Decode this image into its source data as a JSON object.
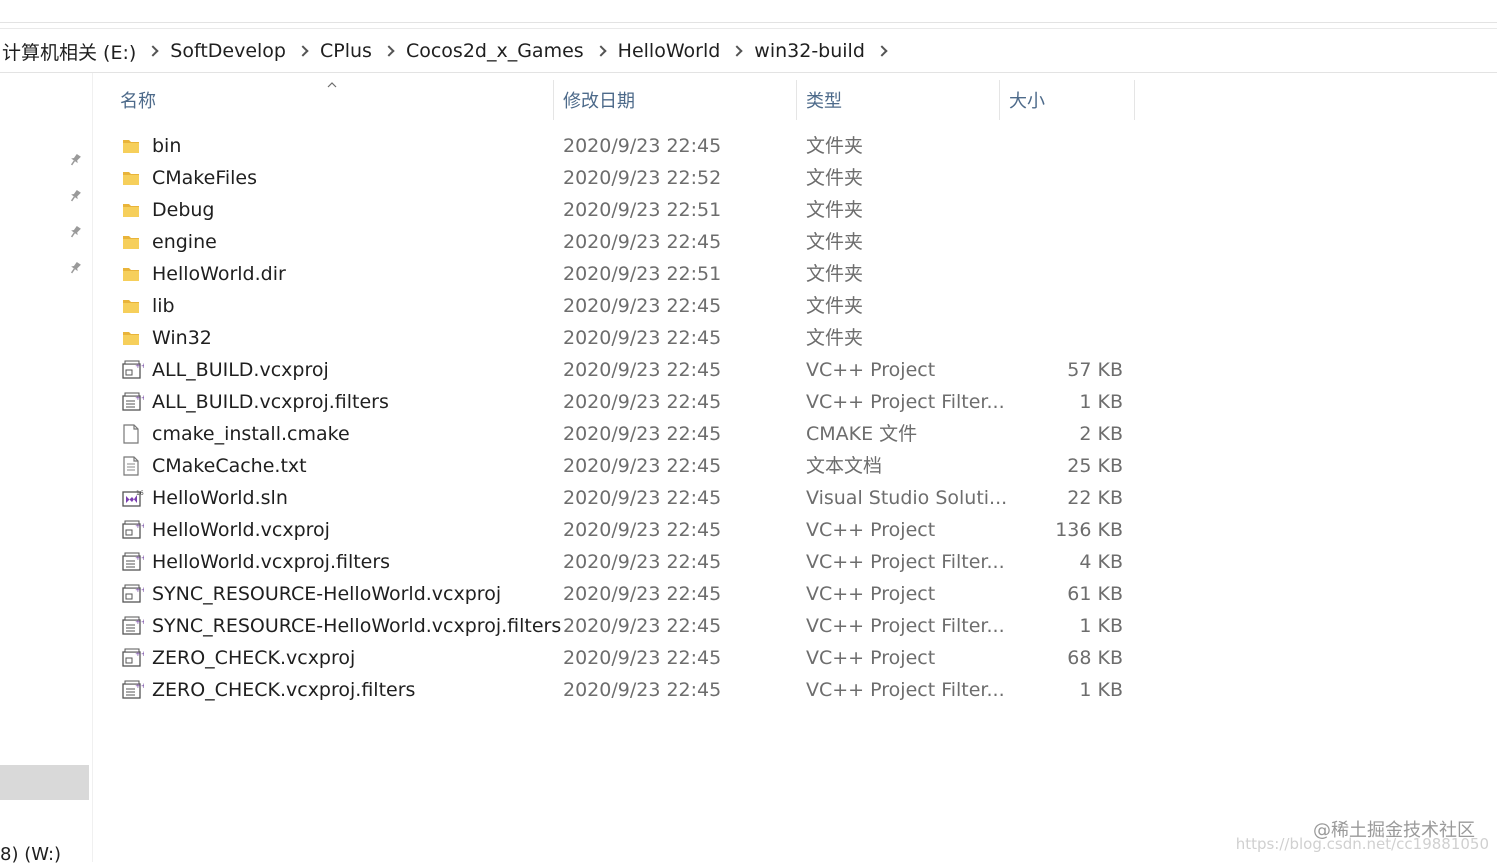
{
  "breadcrumb": [
    "计算机相关 (E:)",
    "SoftDevelop",
    "CPlus",
    "Cocos2d_x_Games",
    "HelloWorld",
    "win32-build"
  ],
  "nav_pane": {
    "drive_label": "8) (W:)"
  },
  "columns": {
    "name": "名称",
    "date": "修改日期",
    "type": "类型",
    "size": "大小"
  },
  "files": [
    {
      "name": "bin",
      "date": "2020/9/23 22:45",
      "type": "文件夹",
      "size": "",
      "icon": "folder-icon"
    },
    {
      "name": "CMakeFiles",
      "date": "2020/9/23 22:52",
      "type": "文件夹",
      "size": "",
      "icon": "folder-icon"
    },
    {
      "name": "Debug",
      "date": "2020/9/23 22:51",
      "type": "文件夹",
      "size": "",
      "icon": "folder-icon"
    },
    {
      "name": "engine",
      "date": "2020/9/23 22:45",
      "type": "文件夹",
      "size": "",
      "icon": "folder-icon"
    },
    {
      "name": "HelloWorld.dir",
      "date": "2020/9/23 22:51",
      "type": "文件夹",
      "size": "",
      "icon": "folder-icon"
    },
    {
      "name": "lib",
      "date": "2020/9/23 22:45",
      "type": "文件夹",
      "size": "",
      "icon": "folder-icon"
    },
    {
      "name": "Win32",
      "date": "2020/9/23 22:45",
      "type": "文件夹",
      "size": "",
      "icon": "folder-icon"
    },
    {
      "name": "ALL_BUILD.vcxproj",
      "date": "2020/9/23 22:45",
      "type": "VC++ Project",
      "size": "57 KB",
      "icon": "vcxproj-icon"
    },
    {
      "name": "ALL_BUILD.vcxproj.filters",
      "date": "2020/9/23 22:45",
      "type": "VC++ Project Filter...",
      "size": "1 KB",
      "icon": "filters-icon"
    },
    {
      "name": "cmake_install.cmake",
      "date": "2020/9/23 22:45",
      "type": "CMAKE 文件",
      "size": "2 KB",
      "icon": "blank-file-icon"
    },
    {
      "name": "CMakeCache.txt",
      "date": "2020/9/23 22:45",
      "type": "文本文档",
      "size": "25 KB",
      "icon": "text-file-icon"
    },
    {
      "name": "HelloWorld.sln",
      "date": "2020/9/23 22:45",
      "type": "Visual Studio Soluti...",
      "size": "22 KB",
      "icon": "sln-icon"
    },
    {
      "name": "HelloWorld.vcxproj",
      "date": "2020/9/23 22:45",
      "type": "VC++ Project",
      "size": "136 KB",
      "icon": "vcxproj-icon"
    },
    {
      "name": "HelloWorld.vcxproj.filters",
      "date": "2020/9/23 22:45",
      "type": "VC++ Project Filter...",
      "size": "4 KB",
      "icon": "filters-icon"
    },
    {
      "name": "SYNC_RESOURCE-HelloWorld.vcxproj",
      "date": "2020/9/23 22:45",
      "type": "VC++ Project",
      "size": "61 KB",
      "icon": "vcxproj-icon"
    },
    {
      "name": "SYNC_RESOURCE-HelloWorld.vcxproj.filters",
      "date": "2020/9/23 22:45",
      "type": "VC++ Project Filter...",
      "size": "1 KB",
      "icon": "filters-icon"
    },
    {
      "name": "ZERO_CHECK.vcxproj",
      "date": "2020/9/23 22:45",
      "type": "VC++ Project",
      "size": "68 KB",
      "icon": "vcxproj-icon"
    },
    {
      "name": "ZERO_CHECK.vcxproj.filters",
      "date": "2020/9/23 22:45",
      "type": "VC++ Project Filter...",
      "size": "1 KB",
      "icon": "filters-icon"
    }
  ],
  "watermark": {
    "main": "@稀土掘金技术社区",
    "url": "https://blog.csdn.net/cc19881050"
  },
  "colors": {
    "folder": "#f3c443",
    "header_text": "#4d6a8a",
    "secondary_text": "#6d6d6d",
    "selection": "#d9d9d9"
  }
}
